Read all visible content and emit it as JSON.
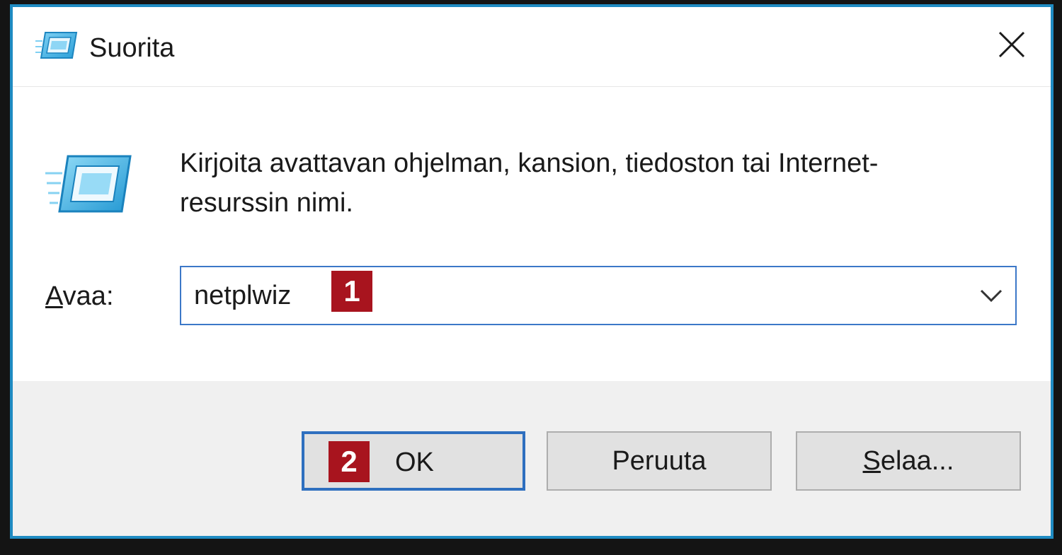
{
  "window": {
    "title": "Suorita",
    "icon": "run-icon",
    "close_icon": "close-icon",
    "accent_color": "#1f8bc2"
  },
  "content": {
    "instruction": "Kirjoita avattavan ohjelman, kansion, tiedoston tai Internet-resurssin nimi.",
    "open_label_accel": "A",
    "open_label_rest": "vaa:",
    "open_value": "netplwiz",
    "dropdown_icon": "chevron-down-icon"
  },
  "annotations": {
    "badge_1": "1",
    "badge_2": "2",
    "badge_color": "#a8141e"
  },
  "buttons": {
    "ok_label": "OK",
    "cancel_label": "Peruuta",
    "browse_accel": "S",
    "browse_rest": "elaa..."
  }
}
